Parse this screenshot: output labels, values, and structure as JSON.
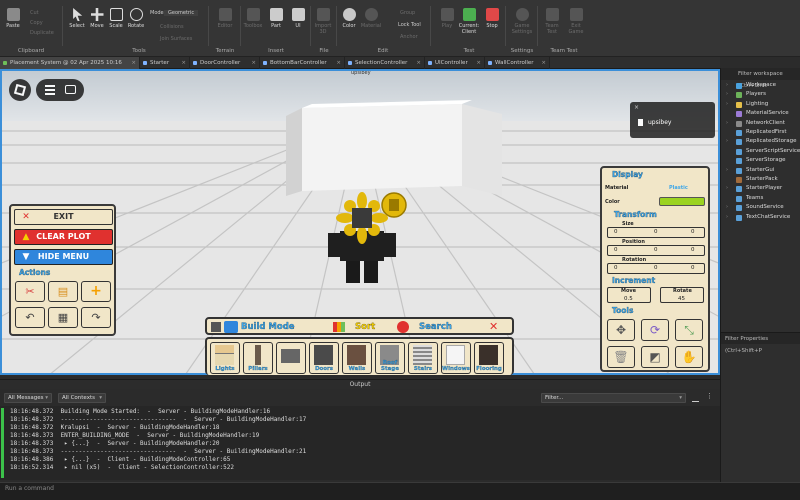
{
  "ribbon": {
    "clipboard": {
      "paste": "Paste",
      "cut": "Cut",
      "copy": "Copy",
      "duplicate": "Duplicate",
      "label": "Clipboard"
    },
    "tools": {
      "select": "Select",
      "move": "Move",
      "scale": "Scale",
      "rotate": "Rotate",
      "label": "Tools",
      "mode_label": "Mode:",
      "mode_value": "Geometric",
      "collisions": "Collisions",
      "join_surfaces": "Join Surfaces"
    },
    "terrain": {
      "editor": "Editor",
      "label": "Terrain"
    },
    "insert": {
      "toolbox": "Toolbox",
      "part": "Part",
      "ui": "UI",
      "label": "Insert"
    },
    "file": {
      "import3d": "Import 3D",
      "label": "File"
    },
    "edit": {
      "color": "Color",
      "material": "Material",
      "group": "Group",
      "lock_tool": "Lock Tool",
      "anchor": "Anchor",
      "label": "Edit"
    },
    "test": {
      "play": "Play",
      "current_client": "Current: Client",
      "stop": "Stop",
      "label": "Test"
    },
    "settings": {
      "game_settings": "Game Settings",
      "label": "Settings"
    },
    "team_test": {
      "team_test": "Team Test",
      "exit_game": "Exit Game",
      "label": "Team Test"
    }
  },
  "tabs": [
    {
      "label": "Placement System @ 02 Apr 2025 10:16",
      "active": true
    },
    {
      "label": "Starter",
      "active": false
    },
    {
      "label": "DoorController",
      "active": false
    },
    {
      "label": "BottomBarController",
      "active": false
    },
    {
      "label": "SelectionController",
      "active": false
    },
    {
      "label": "UIController",
      "active": false
    },
    {
      "label": "WallController",
      "active": false
    }
  ],
  "viewport": {
    "player_name_tag": "upsibey",
    "player_card_name": "upsibey"
  },
  "left_menu": {
    "exit": "EXIT",
    "clear_plot": "CLEAR PLOT",
    "hide_menu": "HIDE MENU",
    "actions_title": "Actions",
    "colors": {
      "exit": "#e0312f",
      "clear_plot": "#e0312f",
      "hide_menu": "#2f86dc"
    }
  },
  "build_bar": {
    "build_mode": "Build Mode",
    "sort": "Sort",
    "search": "Search",
    "items": [
      "Lights",
      "Pillars",
      "",
      "Doors",
      "Walls",
      "Roof Stage",
      "Stairs",
      "Windows",
      "Flooring"
    ]
  },
  "right_panel": {
    "display_title": "Display",
    "material_label": "Material",
    "material_value": "Plastic",
    "color_label": "Color",
    "color_value": "#9bd321",
    "transform_title": "Transform",
    "size_label": "Size",
    "size": [
      "0",
      "0",
      "0"
    ],
    "position_label": "Position",
    "position": [
      "0",
      "0",
      "0"
    ],
    "rotation_label": "Rotation",
    "rotation": [
      "0",
      "0",
      "0"
    ],
    "increment_title": "Increment",
    "move_label": "Move",
    "move_value": "0.5",
    "rotate_label": "Rotate",
    "rotate_value": "45",
    "tools_title": "Tools"
  },
  "explorer": {
    "filter": "Filter workspace (Ctrl+Shift",
    "items": [
      {
        "label": "Workspace",
        "color": "#4aa3df",
        "expand": true
      },
      {
        "label": "Players",
        "color": "#6db35a",
        "expand": true
      },
      {
        "label": "Lighting",
        "color": "#e5c04a",
        "expand": true
      },
      {
        "label": "MaterialService",
        "color": "#9c7bd6",
        "expand": false
      },
      {
        "label": "NetworkClient",
        "color": "#8a8a8a",
        "expand": true
      },
      {
        "label": "ReplicatedFirst",
        "color": "#5aa0d8",
        "expand": false
      },
      {
        "label": "ReplicatedStorage",
        "color": "#5aa0d8",
        "expand": true
      },
      {
        "label": "ServerScriptService",
        "color": "#5aa0d8",
        "expand": false
      },
      {
        "label": "ServerStorage",
        "color": "#5aa0d8",
        "expand": false
      },
      {
        "label": "StarterGui",
        "color": "#5aa0d8",
        "expand": true
      },
      {
        "label": "StarterPack",
        "color": "#a26c3c",
        "expand": false
      },
      {
        "label": "StarterPlayer",
        "color": "#5aa0d8",
        "expand": true
      },
      {
        "label": "Teams",
        "color": "#5aa0d8",
        "expand": false
      },
      {
        "label": "SoundService",
        "color": "#5aa0d8",
        "expand": true
      },
      {
        "label": "TextChatService",
        "color": "#5aa0d8",
        "expand": true
      }
    ],
    "properties_filter": "Filter Properties (Ctrl+Shift+P"
  },
  "output": {
    "title": "Output",
    "all_messages": "All Messages",
    "all_contexts": "All Contexts",
    "filter": "Filter...",
    "lines": [
      "18:16:48.372  Building Mode Started:  -  Server - BuildingModeHandler:16",
      "18:16:48.372  --------------------------------  -  Server - BuildingModeHandler:17",
      "18:16:48.372  Kralupsi  -  Server - BuildingModeHandler:18",
      "18:16:48.373  ENTER_BUILDING_MODE  -  Server - BuildingModeHandler:19",
      "18:16:48.373   ▸ {...}  -  Server - BuildingModeHandler:20",
      "18:16:48.373  --------------------------------  -  Server - BuildingModeHandler:21",
      "18:16:48.386   ▸ {...}  -  Client - BuildingModeController:65",
      "18:16:52.314   ▸ nil (x5)  -  Client - SelectionController:522"
    ]
  },
  "command_bar": {
    "placeholder": "Run a command"
  }
}
